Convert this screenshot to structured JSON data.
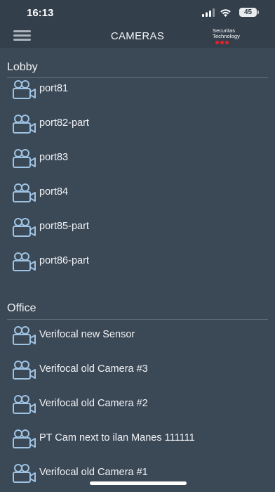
{
  "status_bar": {
    "time": "16:13",
    "battery": "45"
  },
  "nav": {
    "title": "CAMERAS",
    "brand_line1": "Securitas",
    "brand_line2": "Technology"
  },
  "sections": [
    {
      "title": "Lobby",
      "cameras": [
        "port81",
        "port82-part",
        "port83",
        "port84",
        "port85-part",
        "port86-part"
      ]
    },
    {
      "title": "Office",
      "cameras": [
        "Verifocal new Sensor",
        "Verifocal old Camera #3",
        "Verifocal old Camera #2",
        "PT Cam next to ilan Manes 111111",
        "Verifocal old Camera #1"
      ]
    }
  ],
  "colors": {
    "background": "#3b4856",
    "bar": "#343f4c",
    "icon": "#9fc3e3",
    "brand_red": "#e5202e"
  },
  "icons": {
    "menu": "hamburger-menu-icon",
    "camera": "video-camera-icon"
  }
}
